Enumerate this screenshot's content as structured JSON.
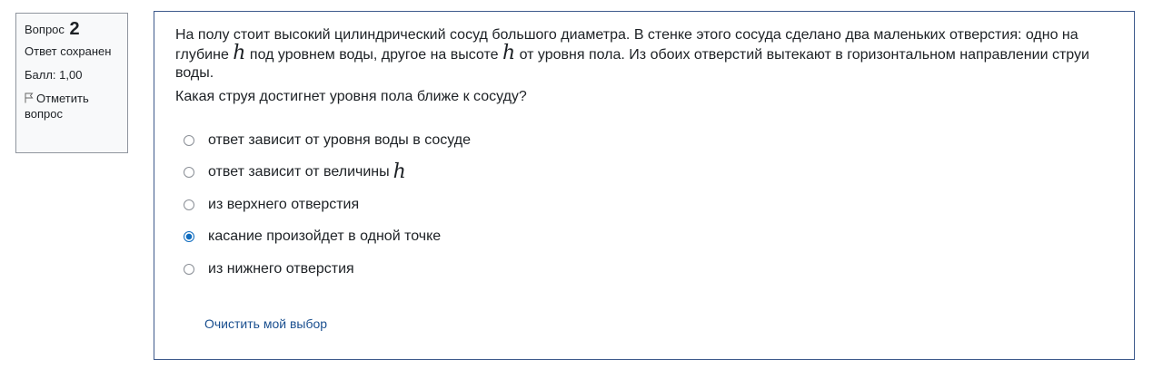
{
  "info": {
    "question_label": "Вопрос",
    "question_number": "2",
    "state": "Ответ сохранен",
    "grade": "Балл: 1,00",
    "flag_label": "Отметить вопрос",
    "flag_icon": "flag-icon"
  },
  "question": {
    "text_1": "На полу стоит высокий цилиндрический сосуд большого диаметра. В стенке этого сосуда сделано два маленьких отверстия: одно на глубине ",
    "var": "h",
    "text_2": " под уровнем воды, другое на высоте ",
    "text_3": " от уровня пола. Из обоих отверстий вытекают в горизонтальном направлении струи воды.",
    "prompt": "Какая струя достигнет уровня пола ближе к сосуду?"
  },
  "answers": [
    {
      "label": "ответ зависит от уровня воды в сосуде",
      "checked": false
    },
    {
      "label": "ответ зависит от величины",
      "var": "h",
      "checked": false
    },
    {
      "label": "из верхнего отверстия",
      "checked": false
    },
    {
      "label": "касание произойдет в одной точке",
      "checked": true
    },
    {
      "label": "из нижнего отверстия",
      "checked": false
    }
  ],
  "clear_choice": "Очистить мой выбор",
  "colors": {
    "accent": "#0f6cbf",
    "border": "#3e5a8c",
    "link": "#1a4f8f"
  }
}
